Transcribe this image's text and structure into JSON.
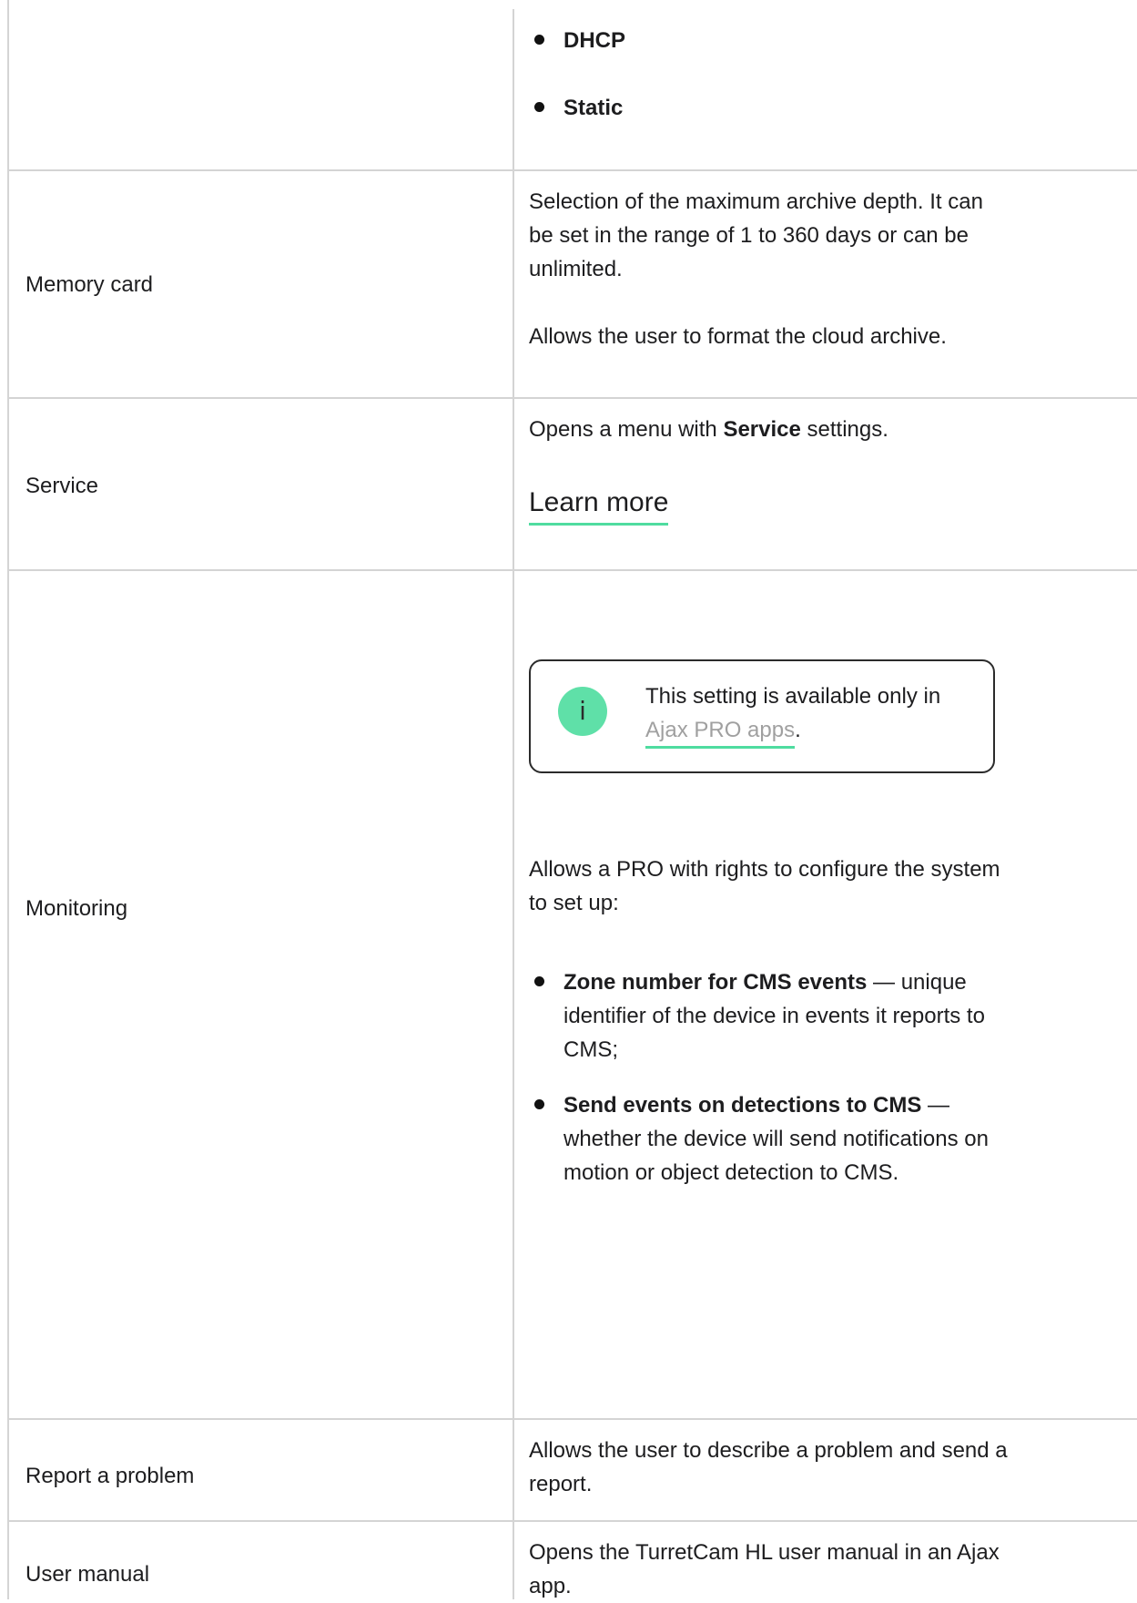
{
  "network_modes": [
    "DHCP",
    "Static"
  ],
  "rows": {
    "memory_card": {
      "label": "Memory card",
      "description_1": "Selection of the maximum archive depth. It can be set in the range of 1 to 360 days or can be unlimited.",
      "description_2": "Allows the user to format the cloud archive."
    },
    "service": {
      "label": "Service",
      "desc_prefix": "Opens a menu with ",
      "desc_bold": "Service",
      "desc_suffix": " settings.",
      "link_text": "Learn more"
    },
    "monitoring": {
      "label": "Monitoring",
      "info_text": "This setting is available only in ",
      "info_link": "Ajax PRO apps",
      "info_suffix": ".",
      "info_icon": "info-icon",
      "description": "Allows a PRO with rights to configure the system to set up:",
      "bullets": [
        {
          "bold": "Zone number for CMS events",
          "text": " — unique identifier of the device in events it reports to CMS;"
        },
        {
          "bold": "Send events on detections to CMS",
          "text": " — whether the device will send notifications on motion or object detection to CMS."
        }
      ]
    },
    "report_problem": {
      "label": "Report a problem",
      "description": "Allows the user to describe a problem and send a report."
    },
    "user_manual": {
      "label": "User manual",
      "description": "Opens the TurretCam HL user manual in an Ajax app."
    }
  },
  "colors": {
    "accent": "#4fdca0",
    "icon_bg": "#5fe0a8",
    "border": "#d4d4d4",
    "link_muted": "#a0a0a0"
  }
}
